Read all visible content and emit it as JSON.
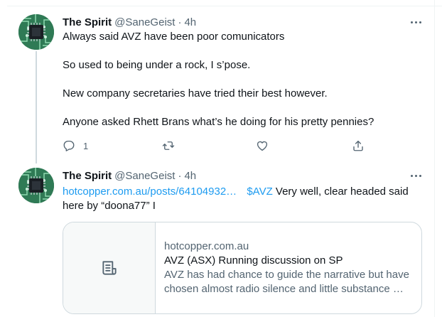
{
  "colors": {
    "accent": "#1d9bf0",
    "text_primary": "#0f1419",
    "text_secondary": "#536471",
    "border": "#cfd9de"
  },
  "tweets": [
    {
      "display_name": "The Spirit",
      "handle": "@SaneGeist",
      "separator": "·",
      "time": "4h",
      "avatar_icon": "circuit-chip-avatar",
      "lines": [
        "Always said AVZ have been poor comunicators",
        "So used to being under a rock, I s’pose.",
        "New company secretaries have tried their best however.",
        "Anyone asked Rhett Brans what’s he doing for his pretty pennies?"
      ],
      "actions": {
        "reply_count": "1",
        "icons": [
          "reply-icon",
          "retweet-icon",
          "like-icon",
          "share-icon"
        ]
      }
    },
    {
      "display_name": "The Spirit",
      "handle": "@SaneGeist",
      "separator": "·",
      "time": "4h",
      "avatar_icon": "circuit-chip-avatar",
      "link": "hotcopper.com.au/posts/64104932…",
      "cashtag": "$AVZ",
      "text_after_links": " Very well, clear headed said",
      "text_line2": "here by “doona77” I",
      "card": {
        "domain": "hotcopper.com.au",
        "title": "AVZ (ASX) Running discussion on SP",
        "description_line1": "AVZ has had chance to guide the narrative but have",
        "description_line2": "chosen almost radio silence and little substance …",
        "thumbnail_icon": "article-icon"
      }
    }
  ]
}
